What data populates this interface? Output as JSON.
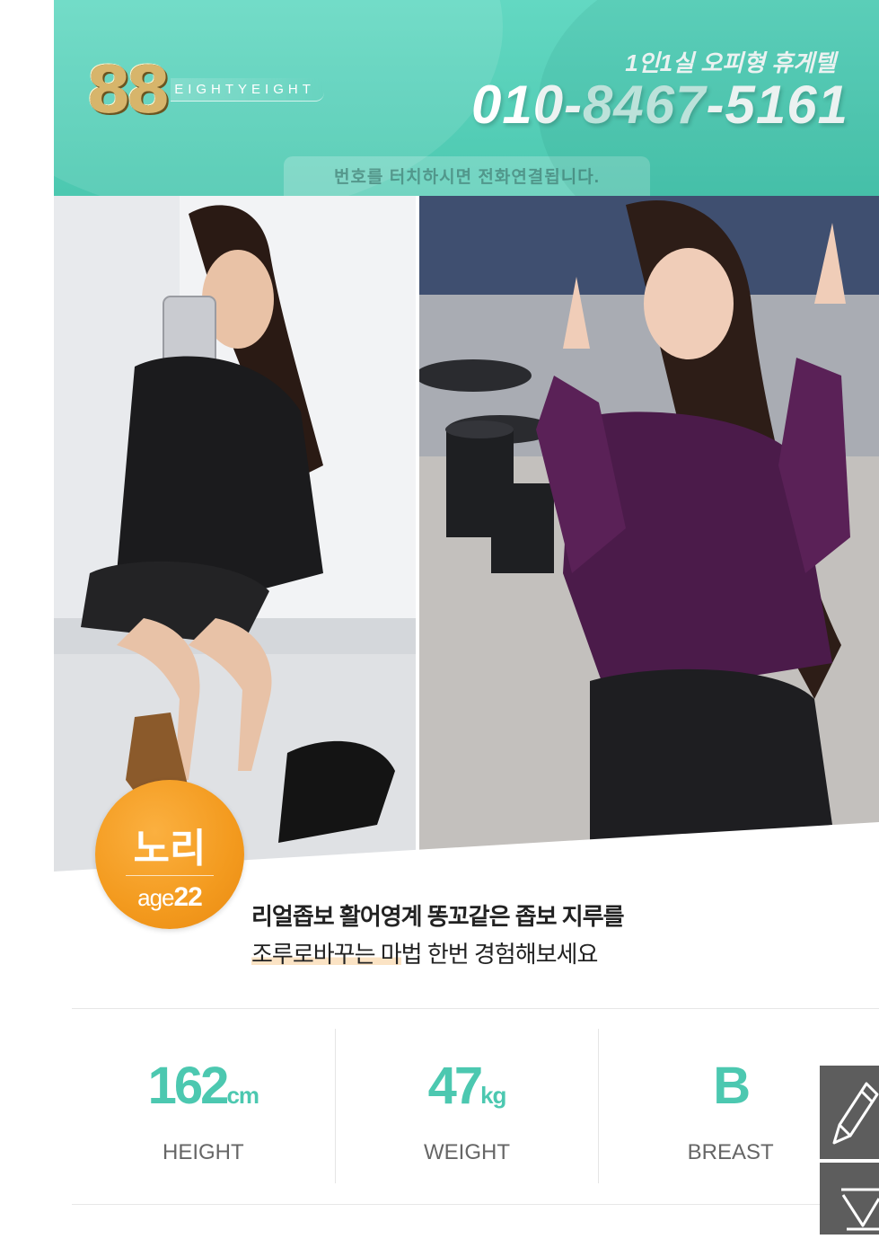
{
  "header": {
    "logo_number": "88",
    "logo_word": "EIGHTYEIGHT",
    "tagline": "1인1실 오피형 휴게텔",
    "phone_prefix": "010-",
    "phone_middle": "8467",
    "phone_suffix": "-5161",
    "hint": "번호를 터치하시면 전화연결됩니다."
  },
  "profile": {
    "name": "노리",
    "age_label": "age",
    "age_value": "22",
    "description_line1": "리얼좁보 활어영계 똥꼬같은 좁보 지루를",
    "description_line2_highlight": "조루로바꾸는 마",
    "description_line2_rest": "법 한번 경험해보세요"
  },
  "stats": [
    {
      "value": "162",
      "unit": "cm",
      "label": "HEIGHT"
    },
    {
      "value": "47",
      "unit": "kg",
      "label": "WEIGHT"
    },
    {
      "value": "B",
      "unit": "",
      "label": "BREAST"
    }
  ],
  "fabs": [
    {
      "icon": "pencil-icon"
    },
    {
      "icon": "triangle-down-icon"
    }
  ],
  "colors": {
    "header_teal": "#4cc8b0",
    "badge_orange": "#f39a1e",
    "stat_teal": "#4cc8b0",
    "fab_gray": "#5d5d5d"
  }
}
